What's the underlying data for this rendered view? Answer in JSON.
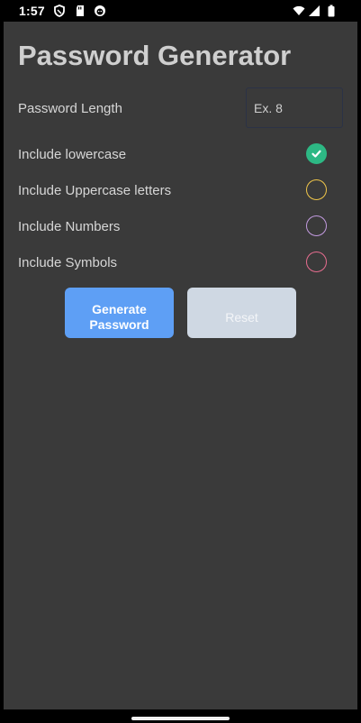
{
  "status_bar": {
    "time": "1:57",
    "left_icons": [
      "shield-icon",
      "sd-card-icon",
      "face-icon"
    ],
    "right_icons": [
      "wifi-icon",
      "signal-icon",
      "battery-icon"
    ]
  },
  "app": {
    "title": "Password Generator",
    "length_label": "Password Length",
    "length_input": {
      "value": "",
      "placeholder": "Ex. 8"
    },
    "options": [
      {
        "label": "Include lowercase",
        "checked": true,
        "color": "#2db884"
      },
      {
        "label": "Include Uppercase letters",
        "checked": false,
        "color": "#f0c64a"
      },
      {
        "label": "Include Numbers",
        "checked": false,
        "color": "#c39be0"
      },
      {
        "label": "Include Symbols",
        "checked": false,
        "color": "#e66d8f"
      }
    ],
    "generate_button": "Generate\nPassword",
    "generate_line1": "Generate",
    "generate_line2": "Password",
    "reset_button": "Reset"
  },
  "colors": {
    "background": "#3a3a3a",
    "primary_button": "#5e9ff5",
    "reset_button": "#cfd8e3"
  }
}
